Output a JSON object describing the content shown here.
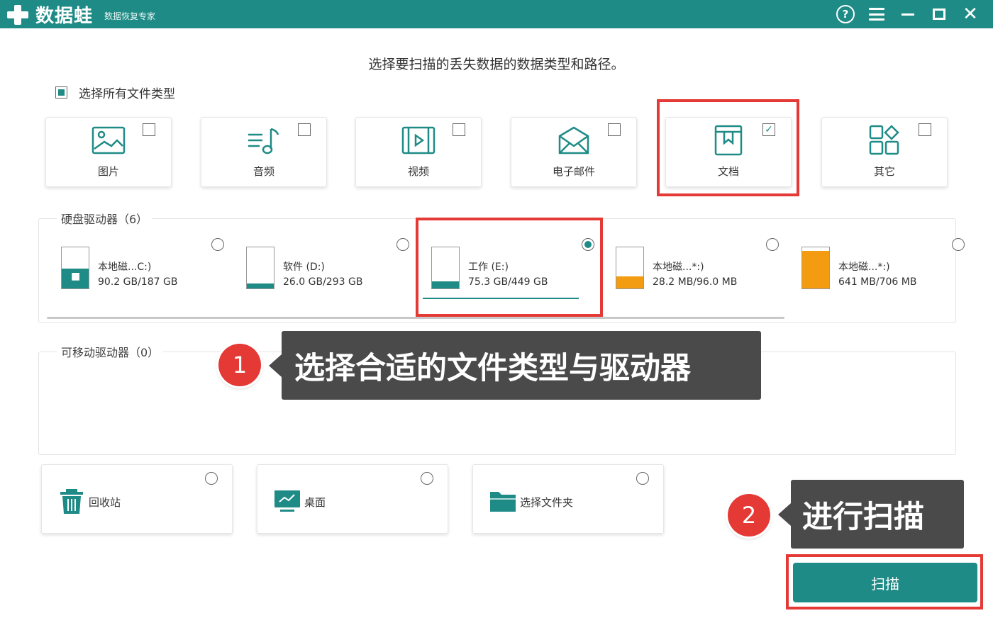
{
  "app": {
    "name": "数据蛙",
    "subtitle": "数据恢复专家"
  },
  "window_controls": {
    "help": "?",
    "close": "✕"
  },
  "heading": "选择要扫描的丢失数据的数据类型和路径。",
  "select_all": {
    "label": "选择所有文件类型",
    "state": "partial"
  },
  "file_types": [
    {
      "label": "图片",
      "icon": "image-icon",
      "checked": false
    },
    {
      "label": "音频",
      "icon": "music-icon",
      "checked": false
    },
    {
      "label": "视频",
      "icon": "video-icon",
      "checked": false
    },
    {
      "label": "电子邮件",
      "icon": "mail-icon",
      "checked": false
    },
    {
      "label": "文档",
      "icon": "document-icon",
      "checked": true
    },
    {
      "label": "其它",
      "icon": "other-icon",
      "checked": false
    }
  ],
  "hard_drives": {
    "title": "硬盘驱动器（6）",
    "items": [
      {
        "name": "本地磁...C:)",
        "size": "90.2 GB/187 GB",
        "used_fraction": 0.48,
        "selected": false,
        "fill_color": "#1f8b86"
      },
      {
        "name": "软件 (D:)",
        "size": "26.0 GB/293 GB",
        "used_fraction": 0.09,
        "selected": false,
        "fill_color": "#1f8b86"
      },
      {
        "name": "工作 (E:)",
        "size": "75.3 GB/449 GB",
        "used_fraction": 0.17,
        "selected": true,
        "fill_color": "#1f8b86"
      },
      {
        "name": "本地磁...*:)",
        "size": "28.2 MB/96.0 MB",
        "used_fraction": 0.29,
        "selected": false,
        "fill_color": "#f39c12"
      },
      {
        "name": "本地磁...*:)",
        "size": "641 MB/706 MB",
        "used_fraction": 0.91,
        "selected": false,
        "fill_color": "#f39c12"
      }
    ]
  },
  "removable_drives": {
    "title": "可移动驱动器（0）"
  },
  "locations": [
    {
      "label": "回收站",
      "icon": "trash-icon"
    },
    {
      "label": "桌面",
      "icon": "desktop-icon"
    },
    {
      "label": "选择文件夹",
      "icon": "folder-icon"
    }
  ],
  "scan_button": "扫描",
  "annotations": [
    {
      "number": "1",
      "text": "选择合适的文件类型与驱动器"
    },
    {
      "number": "2",
      "text": "进行扫描"
    }
  ],
  "colors": {
    "accent": "#1f8b86",
    "highlight": "#e53935",
    "callout_bg": "#4a4a4a",
    "drive_warning": "#f39c12"
  }
}
